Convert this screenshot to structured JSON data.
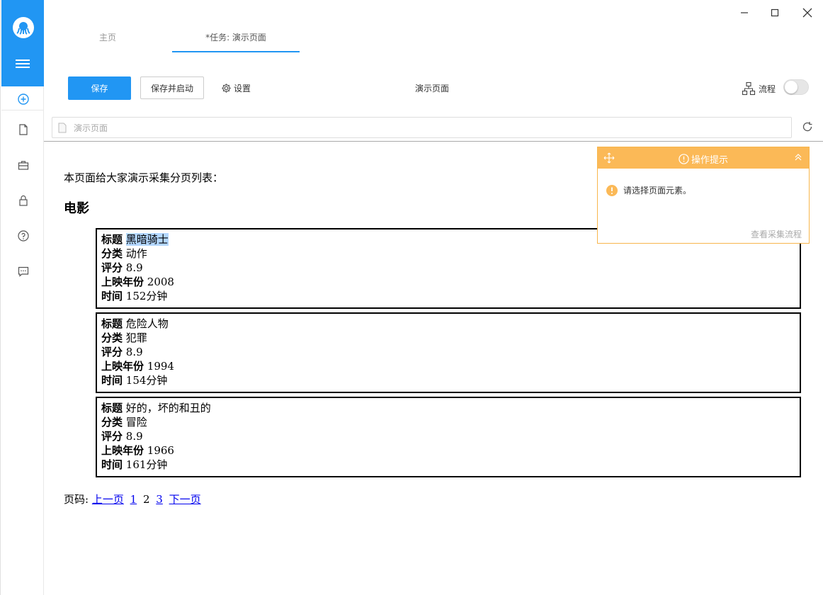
{
  "tabs": {
    "home": "主页",
    "task": "*任务: 演示页面"
  },
  "toolbar": {
    "save": "保存",
    "save_and_run": "保存并启动",
    "settings": "设置",
    "page_name": "演示页面",
    "flow": "流程"
  },
  "urlbar": {
    "text": "演示页面"
  },
  "page": {
    "intro": "本页面给大家演示采集分页列表：",
    "heading": "电影",
    "field_labels": {
      "title": "标题",
      "category": "分类",
      "rating": "评分",
      "year": "上映年份",
      "duration": "时间"
    },
    "movies": [
      {
        "title": "黑暗骑士",
        "category": "动作",
        "rating": "8.9",
        "year": "2008",
        "duration": "152分钟"
      },
      {
        "title": "危险人物",
        "category": "犯罪",
        "rating": "8.9",
        "year": "1994",
        "duration": "154分钟"
      },
      {
        "title": "好的，坏的和丑的",
        "category": "冒险",
        "rating": "8.9",
        "year": "1966",
        "duration": "161分钟"
      }
    ],
    "pager": {
      "label": "页码:",
      "prev": "上一页",
      "p1": "1",
      "p2": "2",
      "p3": "3",
      "next": "下一页"
    }
  },
  "tip": {
    "title": "操作提示",
    "message": "请选择页面元素。",
    "link": "查看采集流程"
  },
  "colors": {
    "accent": "#2196f3",
    "tip": "#fbb957"
  }
}
